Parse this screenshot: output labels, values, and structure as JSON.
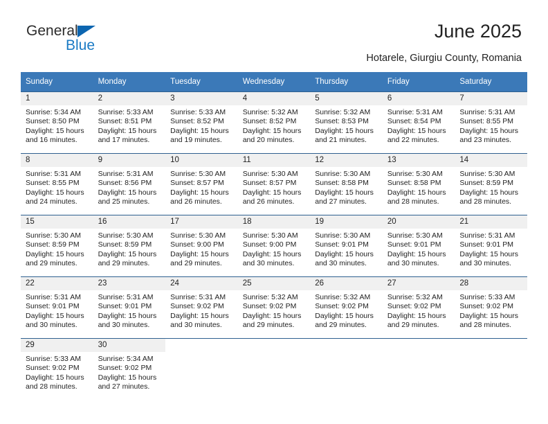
{
  "brand": {
    "name_top": "General",
    "name_bottom": "Blue",
    "accent_color": "#1a7ac4",
    "triangle_color": "#0c65b0"
  },
  "header": {
    "title": "June 2025",
    "subtitle": "Hotarele, Giurgiu County, Romania",
    "header_bg": "#3b79b8",
    "daynum_bg": "#f0f0f0"
  },
  "weekdays": [
    "Sunday",
    "Monday",
    "Tuesday",
    "Wednesday",
    "Thursday",
    "Friday",
    "Saturday"
  ],
  "weeks": [
    [
      {
        "day": "1",
        "sunrise": "Sunrise: 5:34 AM",
        "sunset": "Sunset: 8:50 PM",
        "daylight": "Daylight: 15 hours and 16 minutes."
      },
      {
        "day": "2",
        "sunrise": "Sunrise: 5:33 AM",
        "sunset": "Sunset: 8:51 PM",
        "daylight": "Daylight: 15 hours and 17 minutes."
      },
      {
        "day": "3",
        "sunrise": "Sunrise: 5:33 AM",
        "sunset": "Sunset: 8:52 PM",
        "daylight": "Daylight: 15 hours and 19 minutes."
      },
      {
        "day": "4",
        "sunrise": "Sunrise: 5:32 AM",
        "sunset": "Sunset: 8:52 PM",
        "daylight": "Daylight: 15 hours and 20 minutes."
      },
      {
        "day": "5",
        "sunrise": "Sunrise: 5:32 AM",
        "sunset": "Sunset: 8:53 PM",
        "daylight": "Daylight: 15 hours and 21 minutes."
      },
      {
        "day": "6",
        "sunrise": "Sunrise: 5:31 AM",
        "sunset": "Sunset: 8:54 PM",
        "daylight": "Daylight: 15 hours and 22 minutes."
      },
      {
        "day": "7",
        "sunrise": "Sunrise: 5:31 AM",
        "sunset": "Sunset: 8:55 PM",
        "daylight": "Daylight: 15 hours and 23 minutes."
      }
    ],
    [
      {
        "day": "8",
        "sunrise": "Sunrise: 5:31 AM",
        "sunset": "Sunset: 8:55 PM",
        "daylight": "Daylight: 15 hours and 24 minutes."
      },
      {
        "day": "9",
        "sunrise": "Sunrise: 5:31 AM",
        "sunset": "Sunset: 8:56 PM",
        "daylight": "Daylight: 15 hours and 25 minutes."
      },
      {
        "day": "10",
        "sunrise": "Sunrise: 5:30 AM",
        "sunset": "Sunset: 8:57 PM",
        "daylight": "Daylight: 15 hours and 26 minutes."
      },
      {
        "day": "11",
        "sunrise": "Sunrise: 5:30 AM",
        "sunset": "Sunset: 8:57 PM",
        "daylight": "Daylight: 15 hours and 26 minutes."
      },
      {
        "day": "12",
        "sunrise": "Sunrise: 5:30 AM",
        "sunset": "Sunset: 8:58 PM",
        "daylight": "Daylight: 15 hours and 27 minutes."
      },
      {
        "day": "13",
        "sunrise": "Sunrise: 5:30 AM",
        "sunset": "Sunset: 8:58 PM",
        "daylight": "Daylight: 15 hours and 28 minutes."
      },
      {
        "day": "14",
        "sunrise": "Sunrise: 5:30 AM",
        "sunset": "Sunset: 8:59 PM",
        "daylight": "Daylight: 15 hours and 28 minutes."
      }
    ],
    [
      {
        "day": "15",
        "sunrise": "Sunrise: 5:30 AM",
        "sunset": "Sunset: 8:59 PM",
        "daylight": "Daylight: 15 hours and 29 minutes."
      },
      {
        "day": "16",
        "sunrise": "Sunrise: 5:30 AM",
        "sunset": "Sunset: 8:59 PM",
        "daylight": "Daylight: 15 hours and 29 minutes."
      },
      {
        "day": "17",
        "sunrise": "Sunrise: 5:30 AM",
        "sunset": "Sunset: 9:00 PM",
        "daylight": "Daylight: 15 hours and 29 minutes."
      },
      {
        "day": "18",
        "sunrise": "Sunrise: 5:30 AM",
        "sunset": "Sunset: 9:00 PM",
        "daylight": "Daylight: 15 hours and 30 minutes."
      },
      {
        "day": "19",
        "sunrise": "Sunrise: 5:30 AM",
        "sunset": "Sunset: 9:01 PM",
        "daylight": "Daylight: 15 hours and 30 minutes."
      },
      {
        "day": "20",
        "sunrise": "Sunrise: 5:30 AM",
        "sunset": "Sunset: 9:01 PM",
        "daylight": "Daylight: 15 hours and 30 minutes."
      },
      {
        "day": "21",
        "sunrise": "Sunrise: 5:31 AM",
        "sunset": "Sunset: 9:01 PM",
        "daylight": "Daylight: 15 hours and 30 minutes."
      }
    ],
    [
      {
        "day": "22",
        "sunrise": "Sunrise: 5:31 AM",
        "sunset": "Sunset: 9:01 PM",
        "daylight": "Daylight: 15 hours and 30 minutes."
      },
      {
        "day": "23",
        "sunrise": "Sunrise: 5:31 AM",
        "sunset": "Sunset: 9:01 PM",
        "daylight": "Daylight: 15 hours and 30 minutes."
      },
      {
        "day": "24",
        "sunrise": "Sunrise: 5:31 AM",
        "sunset": "Sunset: 9:02 PM",
        "daylight": "Daylight: 15 hours and 30 minutes."
      },
      {
        "day": "25",
        "sunrise": "Sunrise: 5:32 AM",
        "sunset": "Sunset: 9:02 PM",
        "daylight": "Daylight: 15 hours and 29 minutes."
      },
      {
        "day": "26",
        "sunrise": "Sunrise: 5:32 AM",
        "sunset": "Sunset: 9:02 PM",
        "daylight": "Daylight: 15 hours and 29 minutes."
      },
      {
        "day": "27",
        "sunrise": "Sunrise: 5:32 AM",
        "sunset": "Sunset: 9:02 PM",
        "daylight": "Daylight: 15 hours and 29 minutes."
      },
      {
        "day": "28",
        "sunrise": "Sunrise: 5:33 AM",
        "sunset": "Sunset: 9:02 PM",
        "daylight": "Daylight: 15 hours and 28 minutes."
      }
    ],
    [
      {
        "day": "29",
        "sunrise": "Sunrise: 5:33 AM",
        "sunset": "Sunset: 9:02 PM",
        "daylight": "Daylight: 15 hours and 28 minutes."
      },
      {
        "day": "30",
        "sunrise": "Sunrise: 5:34 AM",
        "sunset": "Sunset: 9:02 PM",
        "daylight": "Daylight: 15 hours and 27 minutes."
      },
      {
        "day": "",
        "sunrise": "",
        "sunset": "",
        "daylight": ""
      },
      {
        "day": "",
        "sunrise": "",
        "sunset": "",
        "daylight": ""
      },
      {
        "day": "",
        "sunrise": "",
        "sunset": "",
        "daylight": ""
      },
      {
        "day": "",
        "sunrise": "",
        "sunset": "",
        "daylight": ""
      },
      {
        "day": "",
        "sunrise": "",
        "sunset": "",
        "daylight": ""
      }
    ]
  ]
}
